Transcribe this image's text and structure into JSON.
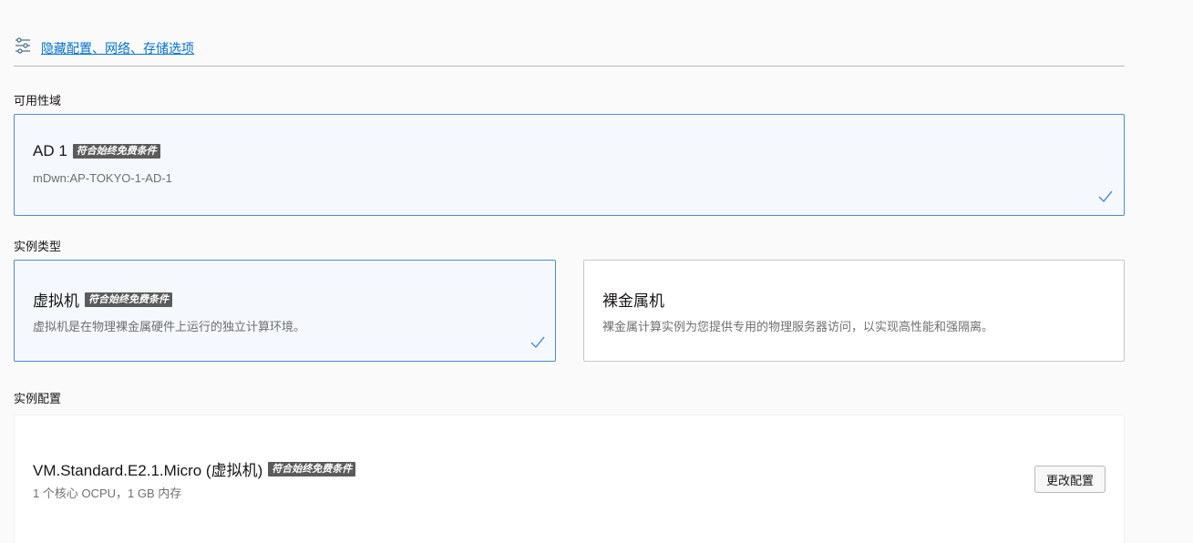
{
  "toggle": {
    "label": "隐藏配置、网络、存储选项"
  },
  "availability_domain": {
    "section_label": "可用性域",
    "card": {
      "title": "AD 1",
      "badge": "符合始终免费条件",
      "subtitle": "mDwn:AP-TOKYO-1-AD-1",
      "selected": true
    }
  },
  "instance_type": {
    "section_label": "实例类型",
    "options": [
      {
        "title": "虚拟机",
        "badge": "符合始终免费条件",
        "description": "虚拟机是在物理裸金属硬件上运行的独立计算环境。",
        "selected": true
      },
      {
        "title": "裸金属机",
        "description": "裸金属计算实例为您提供专用的物理服务器访问，以实现高性能和强隔离。",
        "selected": false
      }
    ]
  },
  "instance_config": {
    "section_label": "实例配置",
    "shape_title": "VM.Standard.E2.1.Micro (虚拟机)",
    "badge": "符合始终免费条件",
    "details": "1 个核心 OCPU，1 GB 内存",
    "change_button": "更改配置"
  },
  "colors": {
    "accent": "#0572ce",
    "selected_border": "#4a8ed0",
    "badge_bg": "#5b5b5b"
  },
  "icons": {
    "toggle": "sliders-icon",
    "selected": "checkmark-icon"
  }
}
